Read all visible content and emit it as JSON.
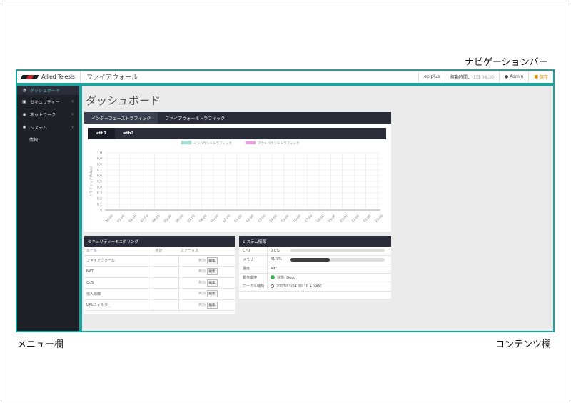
{
  "callouts": {
    "navbar": "ナビゲーションバー",
    "menu": "メニュー欄",
    "content": "コンテンツ欄"
  },
  "navbar": {
    "brand": "Allied Telesis",
    "title": "ファイアウォール",
    "host": "ex-plus",
    "uptime_label": "稼動時間：",
    "uptime_value": "1日 04:30",
    "user": "Admin",
    "save": "保存"
  },
  "sidebar": {
    "items": [
      {
        "icon": "dashboard-icon",
        "label": "ダッシュボード",
        "active": true
      },
      {
        "icon": "lock-icon",
        "label": "セキュリティー"
      },
      {
        "icon": "network-icon",
        "label": "ネットワーク"
      },
      {
        "icon": "gear-icon",
        "label": "システム"
      }
    ],
    "sub_items": [
      "情報"
    ]
  },
  "main": {
    "title": "ダッシュボード",
    "tabs": [
      "インターフェーストラフィック",
      "ファイアウォールトラフィック"
    ],
    "subtabs": [
      "eth1",
      "eth2"
    ]
  },
  "chart_data": {
    "type": "line",
    "series": [
      {
        "name": "インバウンドトラフィック",
        "color": "#a8e0da",
        "values": []
      },
      {
        "name": "アウトバウンドトラフィック",
        "color": "#e6a3e0",
        "values": []
      }
    ],
    "ylabel": "トラフィック(Mbps)",
    "ylim": [
      0,
      1.0
    ],
    "yticks": [
      "1.0",
      "0.9",
      "0.8",
      "0.7",
      "0.6",
      "0.5",
      "0.4",
      "0.3",
      "0.2",
      "0.1",
      "0"
    ],
    "xticks": [
      "00:00",
      "01:00",
      "02:00",
      "03:00",
      "04:00",
      "05:00",
      "06:00",
      "07:00",
      "08:00",
      "09:00",
      "10:00",
      "11:00",
      "12:00",
      "13:00",
      "14:00",
      "15:00",
      "16:00",
      "17:00",
      "18:00",
      "19:00",
      "20:00",
      "21:00",
      "22:00",
      "23:00"
    ],
    "grid": true,
    "legend": "top-center"
  },
  "security": {
    "title": "セキュリティーモニタリング",
    "headers": [
      "ルール",
      "統計",
      "ステータス"
    ],
    "rows": [
      {
        "name": "ファイアウォール",
        "status": "無効",
        "action": "編集"
      },
      {
        "name": "NAT",
        "status": "無効",
        "action": "編集"
      },
      {
        "name": "QoS",
        "status": "無効",
        "action": "編集"
      },
      {
        "name": "侵入防御",
        "status": "無効",
        "action": "編集"
      },
      {
        "name": "URLフィルター",
        "status": "無効",
        "action": "編集"
      }
    ]
  },
  "system": {
    "title": "システム情報",
    "cpu_label": "CPU",
    "cpu_value": "0.0%",
    "cpu_pct": 0,
    "mem_label": "メモリー",
    "mem_value": "41.7%",
    "mem_pct": 41.7,
    "temp_label": "温度",
    "temp_value": "49°",
    "status_label": "動作環境",
    "status_value": "状態: Good",
    "time_label": "ローカル時刻",
    "time_value": "2017/03/04 00:10 +0900"
  }
}
